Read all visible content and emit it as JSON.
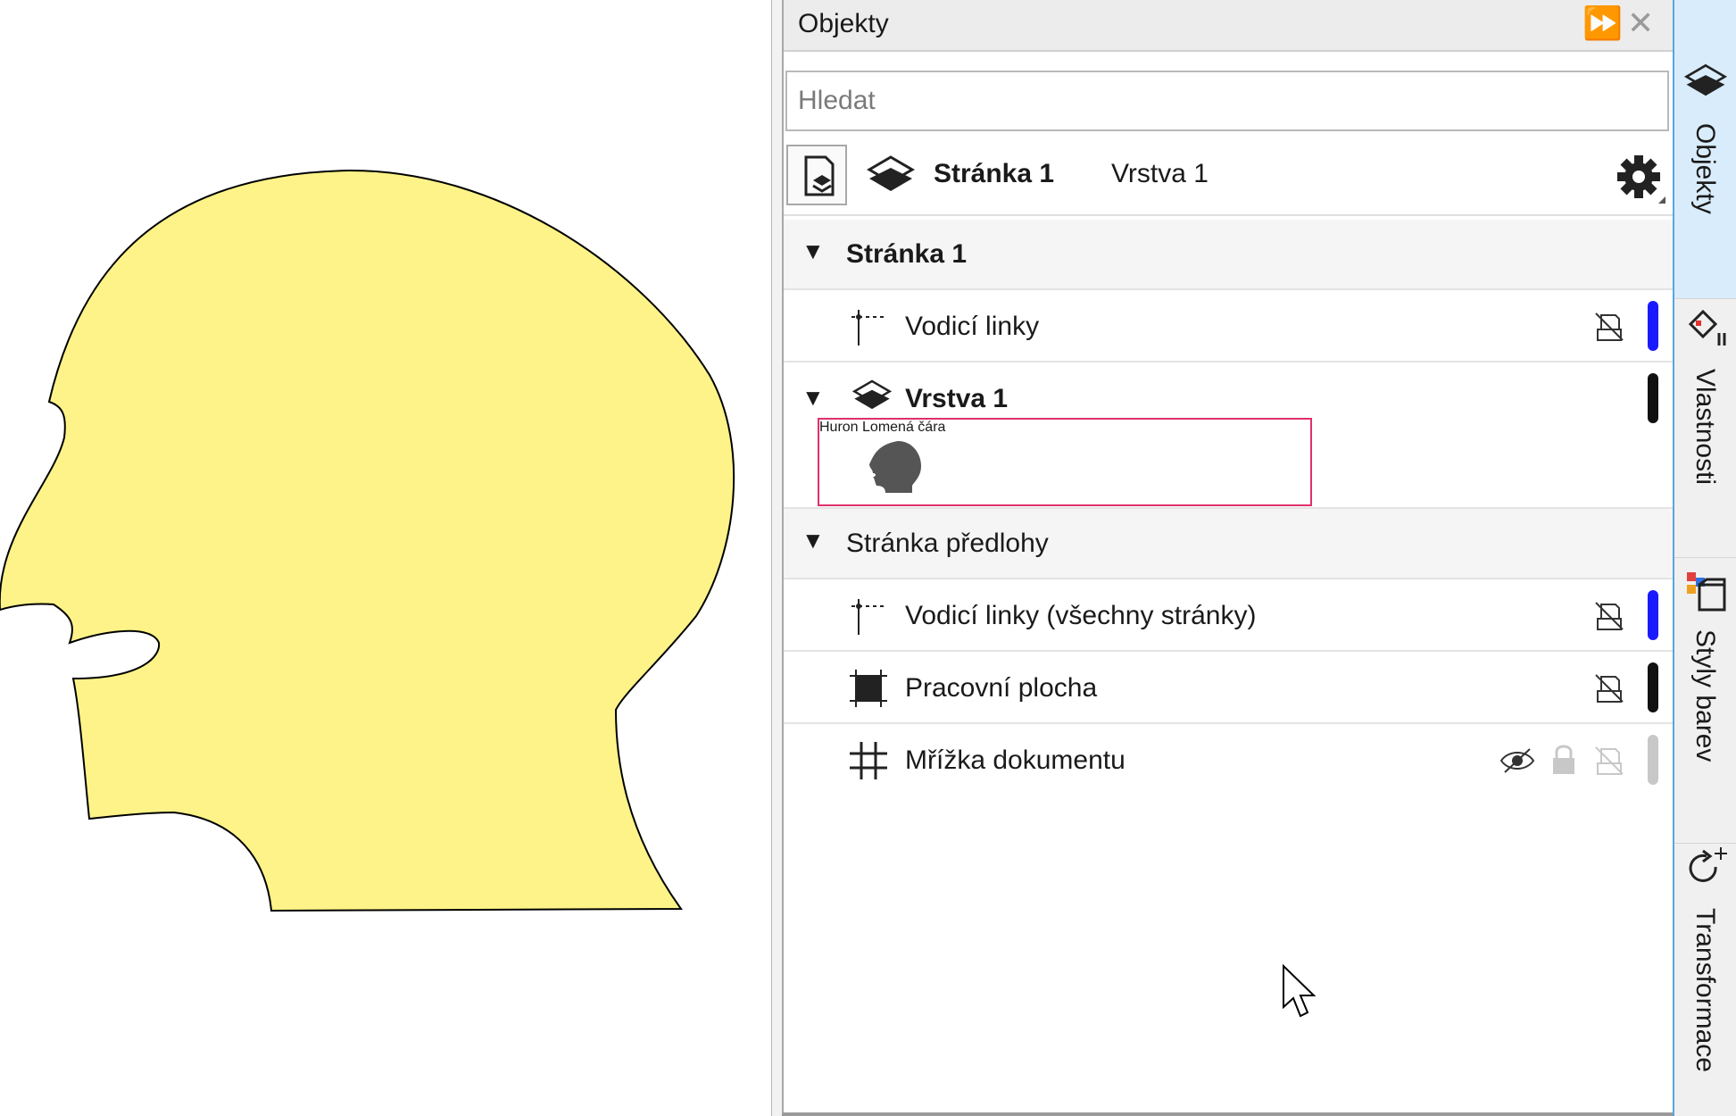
{
  "panel": {
    "title": "Objekty",
    "search_placeholder": "Hledat",
    "toolbar": {
      "page": "Stránka 1",
      "layer": "Vrstva 1"
    },
    "tree": [
      {
        "label": "Stránka 1"
      },
      {
        "label": "Vodicí linky",
        "color": "#1a1aff"
      },
      {
        "label": "Vrstva 1",
        "color": "#111111"
      },
      {
        "label": "Huron Lomená čára",
        "selected": true
      },
      {
        "label": "Stránka předlohy"
      },
      {
        "label": "Vodicí linky (všechny stránky)",
        "color": "#1a1aff"
      },
      {
        "label": "Pracovní plocha",
        "color": "#111111"
      },
      {
        "label": "Mřížka dokumentu",
        "color": "#c8c8c8"
      }
    ]
  },
  "side_tabs": [
    "Objekty",
    "Vlastnosti",
    "Styly barev",
    "Transformace"
  ],
  "canvas": {
    "shape_fill": "#fdf388",
    "shape_stroke": "#000000"
  }
}
